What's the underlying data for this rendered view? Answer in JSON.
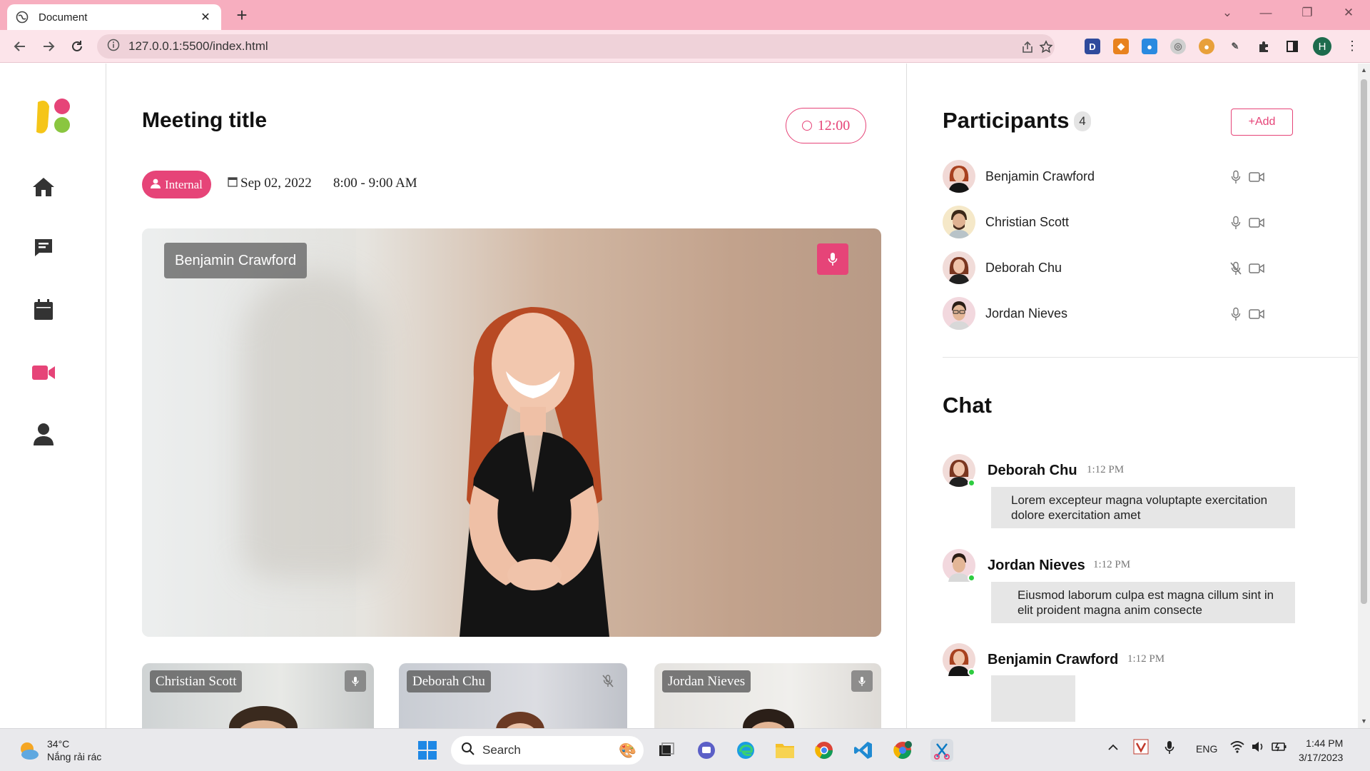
{
  "browser": {
    "tab_title": "Document",
    "url": "127.0.0.1:5500/index.html",
    "profile_initial": "H"
  },
  "meeting": {
    "title": "Meeting title",
    "timer": "12:00",
    "badge": "Internal",
    "date": "Sep 02, 2022",
    "time_range": "8:00 - 9:00 AM",
    "speaker": "Benjamin Crawford",
    "thumbnails": [
      {
        "name": "Christian Scott",
        "muted": false
      },
      {
        "name": "Deborah Chu",
        "muted": true
      },
      {
        "name": "Jordan Nieves",
        "muted": false
      }
    ]
  },
  "participants": {
    "heading": "Participants",
    "count": "4",
    "add_label": "+Add",
    "list": [
      {
        "name": "Benjamin Crawford",
        "muted": false
      },
      {
        "name": "Christian Scott",
        "muted": false
      },
      {
        "name": "Deborah Chu",
        "muted": true
      },
      {
        "name": "Jordan Nieves",
        "muted": false
      }
    ]
  },
  "chat": {
    "heading": "Chat",
    "messages": [
      {
        "name": "Deborah Chu",
        "time": "1:12 PM",
        "text": "Lorem excepteur magna voluptapte exercitation dolore exercitation amet"
      },
      {
        "name": "Jordan Nieves",
        "time": "1:12 PM",
        "text": "Eiusmod laborum culpa est magna cillum sint in elit proident magna anim consecte"
      },
      {
        "name": "Benjamin Crawford",
        "time": "1:12 PM",
        "text": ""
      }
    ]
  },
  "taskbar": {
    "temperature": "34°C",
    "weather": "Nắng rải rác",
    "search": "Search",
    "language": "ENG",
    "time": "1:44 PM",
    "date": "3/17/2023"
  },
  "colors": {
    "accent": "#e64478",
    "tabbar": "#f7aebf",
    "addressbar": "#fce4ea",
    "online": "#2ecc40"
  },
  "icons": {
    "sidebar": [
      "home-icon",
      "chat-icon",
      "calendar-icon",
      "video-icon",
      "user-icon"
    ]
  }
}
